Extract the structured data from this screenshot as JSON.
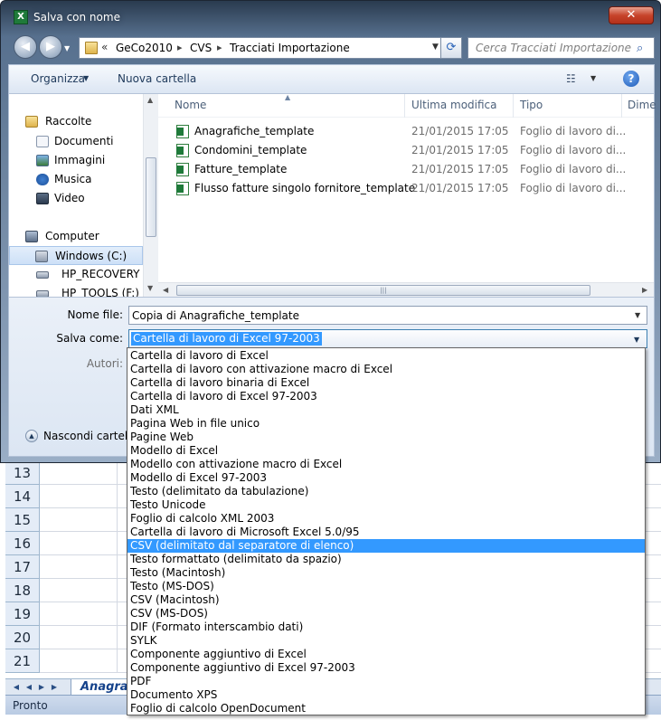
{
  "dialog": {
    "title": "Salva con nome",
    "app_icon_label": "X",
    "close_label": "✕"
  },
  "nav": {
    "back_label": "◀",
    "forward_label": "▶",
    "breadcrumb_prefix": "«",
    "breadcrumbs": [
      "GeCo2010",
      "CVS",
      "Tracciati Importazione"
    ],
    "search_placeholder": "Cerca Tracciati Importazione",
    "icons": {
      "back": "back-arrow",
      "forward": "forward-arrow",
      "refresh": "refresh-icon",
      "search": "search-icon",
      "folder": "folder-icon"
    }
  },
  "toolbar": {
    "organize_label": "Organizza",
    "new_folder_label": "Nuova cartella",
    "views_glyph": "☷",
    "help_glyph": "?"
  },
  "sidebar": {
    "items": [
      {
        "label": "Raccolte",
        "icon": "libraries-icon"
      },
      {
        "label": "Documenti",
        "icon": "documents-icon"
      },
      {
        "label": "Immagini",
        "icon": "pictures-icon"
      },
      {
        "label": "Musica",
        "icon": "music-icon"
      },
      {
        "label": "Video",
        "icon": "video-icon"
      },
      {
        "label": "Computer",
        "icon": "computer-icon"
      },
      {
        "label": "Windows  (C:)",
        "icon": "drive-icon"
      },
      {
        "label": "HP_RECOVERY (D",
        "icon": "drive-icon"
      },
      {
        "label": "HP_TOOLS (F:)",
        "icon": "drive-icon"
      }
    ]
  },
  "files": {
    "columns": [
      "Nome",
      "Ultima modifica",
      "Tipo",
      "Dime"
    ],
    "rows": [
      {
        "name": "Anagrafiche_template",
        "date": "21/01/2015 17:05",
        "type": "Foglio di lavoro di..."
      },
      {
        "name": "Condomini_template",
        "date": "21/01/2015 17:05",
        "type": "Foglio di lavoro di..."
      },
      {
        "name": "Fatture_template",
        "date": "21/01/2015 17:05",
        "type": "Foglio di lavoro di..."
      },
      {
        "name": "Flusso fatture singolo fornitore_template",
        "date": "21/01/2015 17:05",
        "type": "Foglio di lavoro di..."
      }
    ]
  },
  "form": {
    "filename_label": "Nome file:",
    "filename_value": "Copia di Anagrafiche_template",
    "savetype_label": "Salva come:",
    "savetype_value": "Cartella di lavoro di Excel 97-2003",
    "authors_label": "Autori:",
    "hide_folders_label": "Nascondi cartelle"
  },
  "type_options": {
    "selected_index": 15,
    "items": [
      "Cartella di lavoro di Excel",
      "Cartella di lavoro con attivazione macro di Excel",
      "Cartella di lavoro binaria di Excel",
      "Cartella di lavoro di Excel 97-2003",
      "Dati XML",
      "Pagina Web in file unico",
      "Pagine Web",
      "Modello di Excel",
      "Modello con attivazione macro di Excel",
      "Modello di Excel 97-2003",
      "Testo (delimitato da tabulazione)",
      "Testo Unicode",
      "Foglio di calcolo XML 2003",
      "Cartella di lavoro di Microsoft Excel 5.0/95",
      "CSV (delimitato dal separatore di elenco)",
      "CSV (delimitato dal separatore di elenco)",
      "Testo formattato (delimitato da spazio)",
      "Testo (Macintosh)",
      "Testo (MS-DOS)",
      "CSV (Macintosh)",
      "CSV (MS-DOS)",
      "DIF (Formato interscambio dati)",
      "SYLK",
      "Componente aggiuntivo di Excel",
      "Componente aggiuntivo di Excel 97-2003",
      "PDF",
      "Documento XPS",
      "Foglio di calcolo OpenDocument"
    ]
  },
  "excel": {
    "row_numbers": [
      "13",
      "14",
      "15",
      "16",
      "17",
      "18",
      "19",
      "20",
      "21"
    ],
    "sheet_tab": "Anagrafic",
    "status": "Pronto"
  },
  "colors": {
    "selection": "#3399ff",
    "title_bar": "#2a3b4f",
    "close_button": "#c7442b"
  }
}
